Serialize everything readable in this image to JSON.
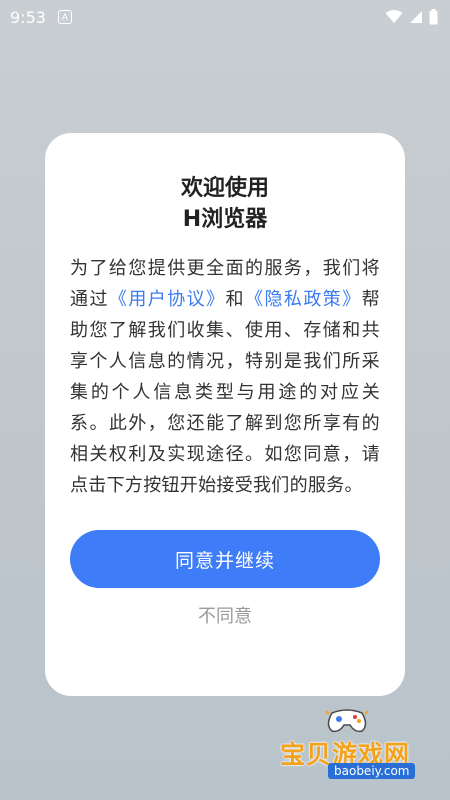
{
  "status_bar": {
    "time": "9:53",
    "notification_badge": "A"
  },
  "dialog": {
    "title_line1": "欢迎使用",
    "title_line2": "H浏览器",
    "body": {
      "part1": "为了给您提供更全面的服务，我们将通过",
      "link_user_agreement": "《用户协议》",
      "and": "和",
      "link_privacy_policy": "《隐私政策》",
      "part2": "帮助您了解我们收集、使用、存储和共享个人信息的情况，特别是我们所采集的个人信息类型与用途的对应关系。此外，您还能了解到您所享有的相关权利及实现途径。如您同意，请点击下方按钮开始接受我们的服务。"
    },
    "agree_label": "同意并继续",
    "disagree_label": "不同意"
  },
  "watermark": {
    "text": "宝贝游戏网",
    "url": "baobeiy.com"
  },
  "colors": {
    "accent": "#3f7cf7",
    "link": "#3a7bf0",
    "muted": "#9a9a9a"
  }
}
